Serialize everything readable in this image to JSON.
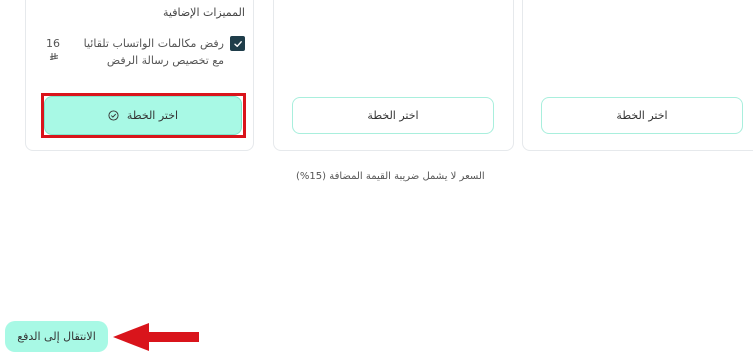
{
  "plans": [
    {
      "section_title": "المميزات الإضافية",
      "feature": {
        "checked": true,
        "text": "رفض مكالمات الواتساب تلقائيا مع تخصيص رسالة الرفض",
        "price": "16",
        "currency_icon": "riyal-icon"
      },
      "button_label": "اختر الخطة",
      "selected": true
    },
    {
      "button_label": "اختر الخطة",
      "selected": false
    },
    {
      "button_label": "اختر الخطة",
      "selected": false
    }
  ],
  "vat_note": "السعر لا يشمل ضريبة القيمة المضافة (15%)",
  "proceed_label": "الانتقال إلى الدفع",
  "colors": {
    "accent": "#a8f9e5",
    "outline": "#a9efdd",
    "checkbox": "#1f3d4a",
    "highlight": "#d9141b"
  }
}
